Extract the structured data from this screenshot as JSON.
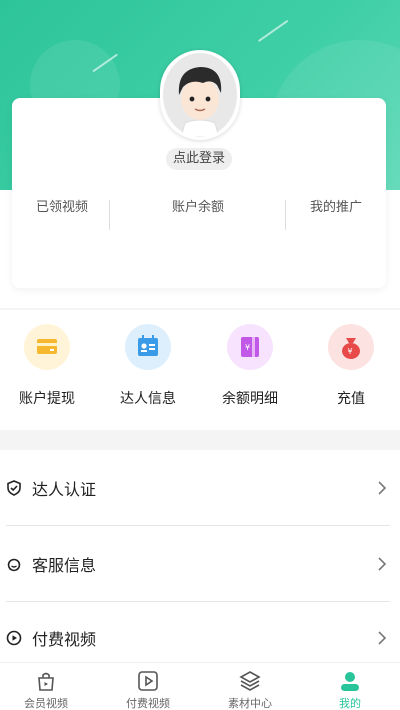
{
  "profile": {
    "login_label": "点此登录",
    "stats": [
      "已领视频",
      "账户余额",
      "我的推广"
    ]
  },
  "quick_actions": [
    {
      "label": "账户提现",
      "icon": "wallet-card-icon",
      "color": "#f5b82e"
    },
    {
      "label": "达人信息",
      "icon": "id-card-icon",
      "color": "#3a9be8"
    },
    {
      "label": "余额明细",
      "icon": "ledger-book-icon",
      "color": "#c158e8"
    },
    {
      "label": "充值",
      "icon": "money-bag-icon",
      "color": "#e84a4a"
    }
  ],
  "menu": [
    {
      "label": "达人认证",
      "icon": "shield-check-icon"
    },
    {
      "label": "客服信息",
      "icon": "headset-smile-icon"
    },
    {
      "label": "付费视频",
      "icon": "play-circle-icon"
    }
  ],
  "tabs": [
    {
      "label": "会员视频",
      "icon": "lock-bag-icon",
      "active": false
    },
    {
      "label": "付费视频",
      "icon": "play-square-icon",
      "active": false
    },
    {
      "label": "素材中心",
      "icon": "layers-icon",
      "active": false
    },
    {
      "label": "我的",
      "icon": "user-icon",
      "active": true
    }
  ],
  "colors": {
    "accent": "#28c49a",
    "header": "#3fcfa6"
  }
}
